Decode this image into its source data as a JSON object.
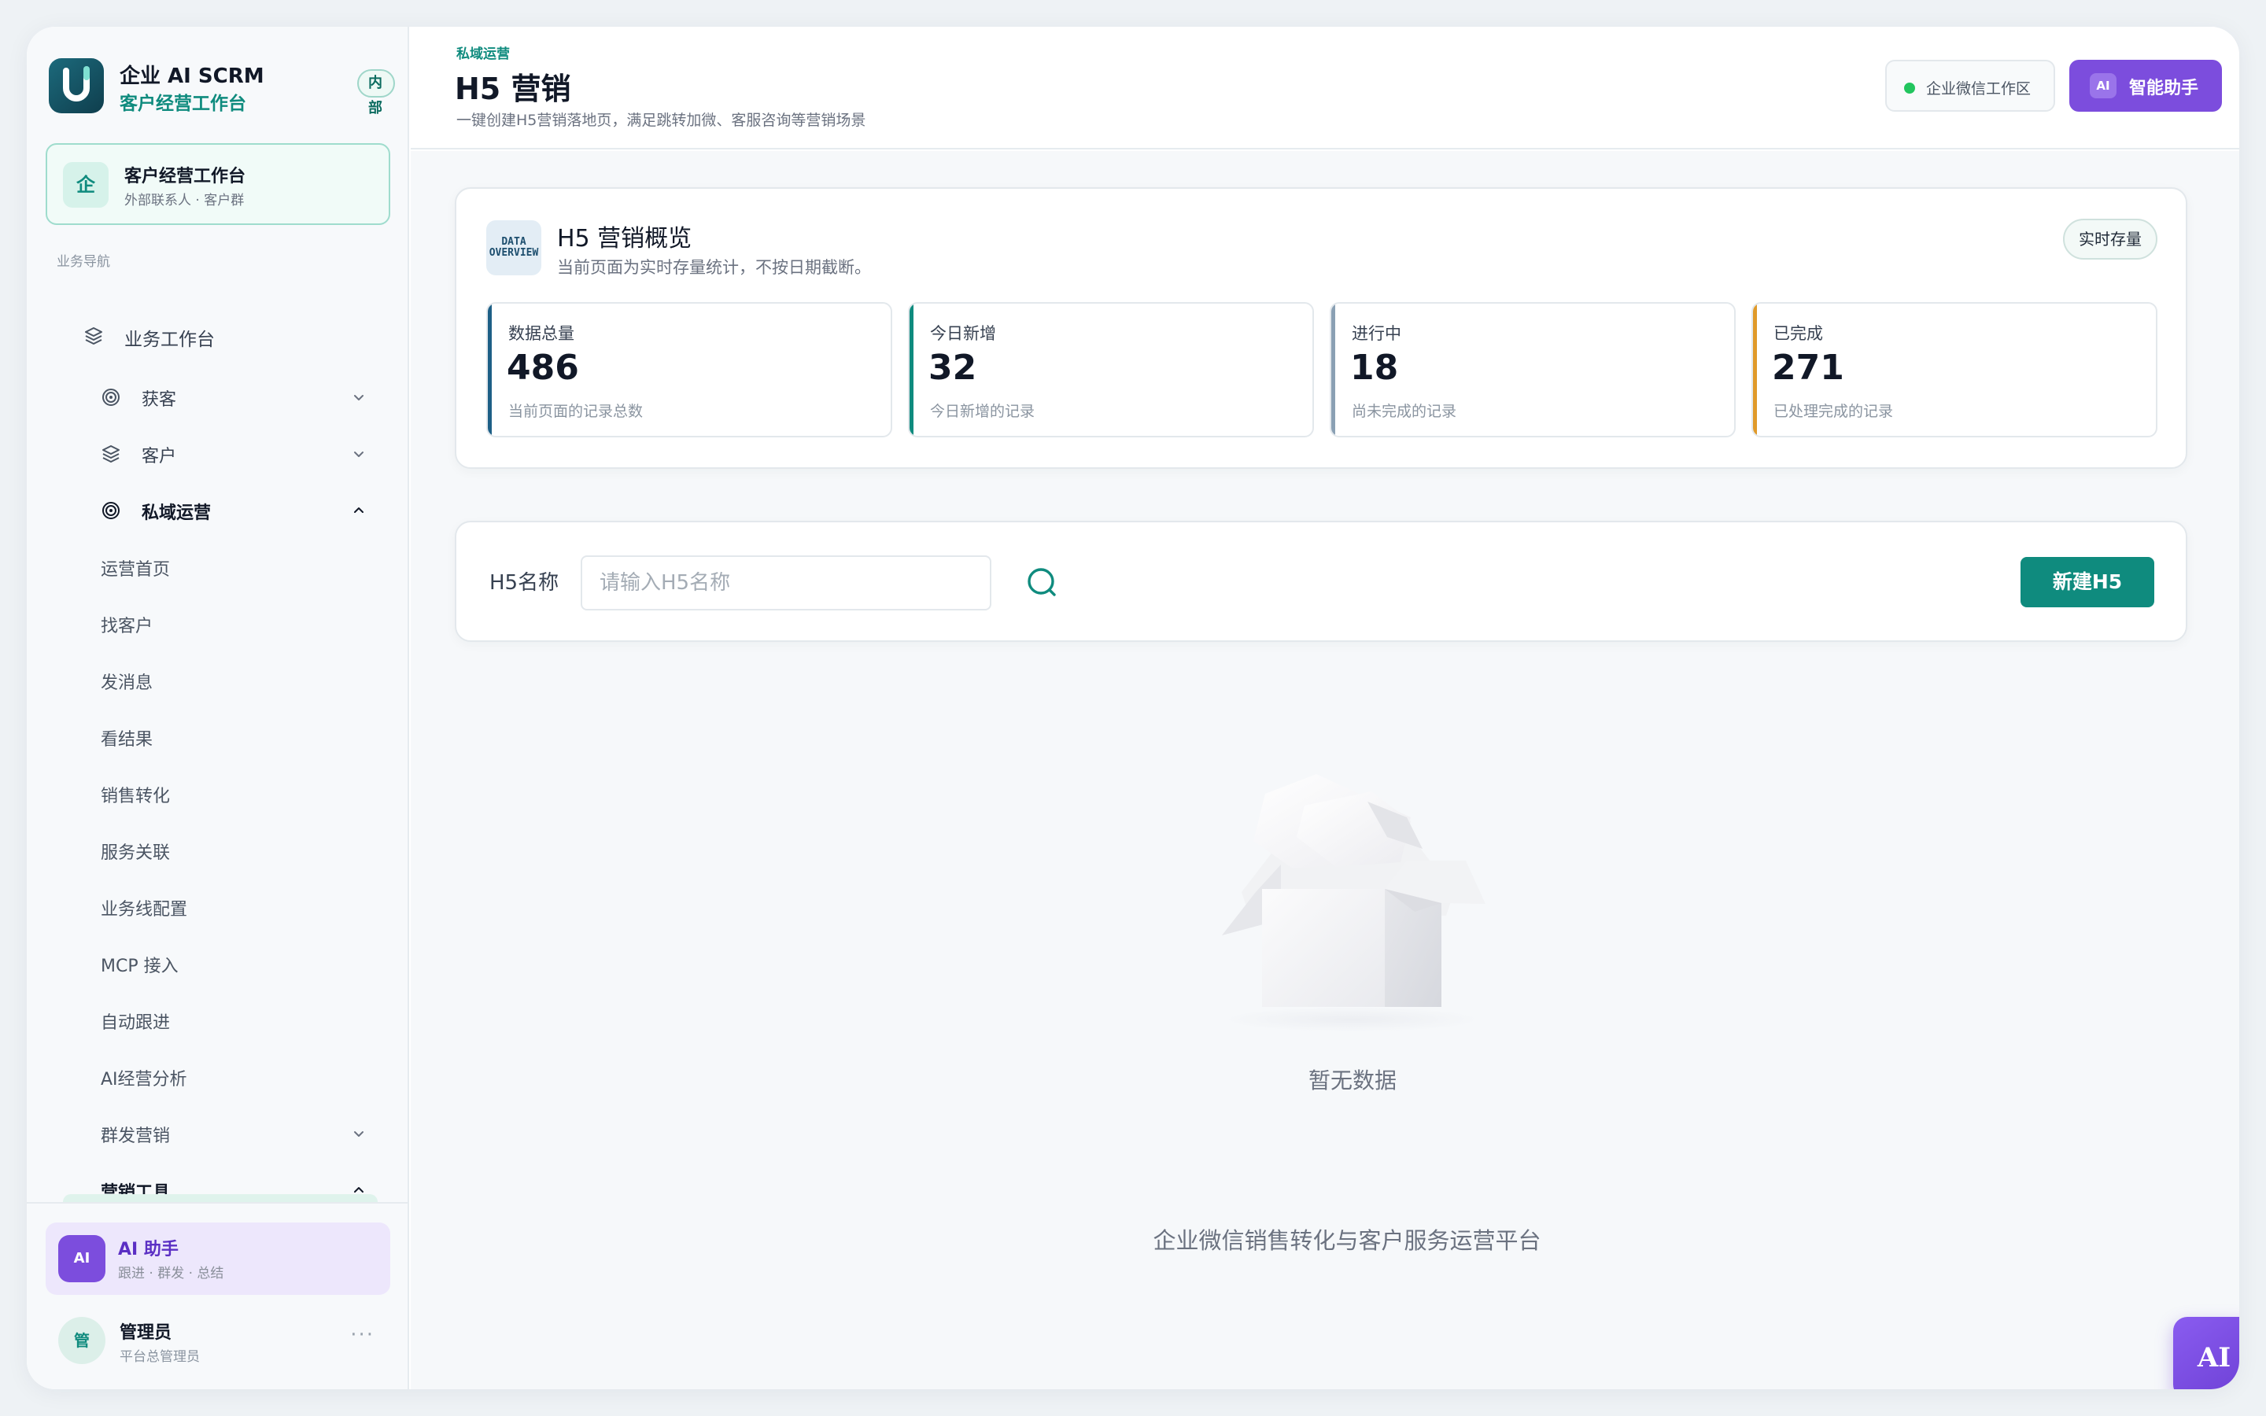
{
  "brand": {
    "title": "企业 AI SCRM",
    "subtitle": "客户经营工作台",
    "badge": "内部",
    "logo_letter": "U"
  },
  "workspace_card": {
    "icon_text": "企",
    "title": "客户经营工作台",
    "subtitle": "外部联系人 · 客户群"
  },
  "sidebar": {
    "section_label": "业务导航",
    "items": [
      {
        "label": "业务工作台",
        "icon": "layers-icon"
      },
      {
        "label": "获客",
        "icon": "target-icon",
        "expanded": false
      },
      {
        "label": "客户",
        "icon": "layers-icon",
        "expanded": false
      },
      {
        "label": "私域运营",
        "icon": "target-icon",
        "expanded": true
      }
    ],
    "sub_items": [
      "运营首页",
      "找客户",
      "发消息",
      "看结果",
      "销售转化",
      "服务关联",
      "业务线配置",
      "MCP 接入",
      "自动跟进",
      "AI经营分析"
    ],
    "group_send": {
      "label": "群发营销",
      "expanded": false
    },
    "marketing_tools": {
      "label": "营销工具",
      "expanded": true
    }
  },
  "ai_assistant_card": {
    "avatar": "AI",
    "title": "AI 助手",
    "subtitle": "跟进 · 群发 · 总结"
  },
  "user": {
    "avatar": "管",
    "name": "管理员",
    "role": "平台总管理员",
    "more": "···"
  },
  "header": {
    "breadcrumb": "私域运营",
    "title": "H5 营销",
    "description": "一键创建H5营销落地页，满足跳转加微、客服咨询等营销场景",
    "workspace_status": "企业微信工作区",
    "ai_button_badge": "AI",
    "ai_button_label": "智能助手"
  },
  "overview": {
    "icon_line1": "DATA",
    "icon_line2": "OVERVIEW",
    "title": "H5 营销概览",
    "subtitle": "当前页面为实时存量统计，不按日期截断。",
    "tag": "实时存量",
    "stats": [
      {
        "label": "数据总量",
        "value": "486",
        "hint": "当前页面的记录总数",
        "color": "#1d5f86"
      },
      {
        "label": "今日新增",
        "value": "32",
        "hint": "今日新增的记录",
        "color": "#0f8b7e"
      },
      {
        "label": "进行中",
        "value": "18",
        "hint": "尚未完成的记录",
        "color": "#8aa0b4"
      },
      {
        "label": "已完成",
        "value": "271",
        "hint": "已处理完成的记录",
        "color": "#e09a2a"
      }
    ]
  },
  "filter": {
    "label": "H5名称",
    "placeholder": "请输入H5名称",
    "value": "",
    "new_button": "新建H5"
  },
  "empty": {
    "text": "暂无数据"
  },
  "footer": {
    "text": "企业微信销售转化与客户服务运营平台"
  },
  "float_button": {
    "label": "AI"
  },
  "colors": {
    "brand_teal": "#0f8b7e",
    "ai_purple": "#7c4ddd",
    "status_green": "#22c55e"
  }
}
